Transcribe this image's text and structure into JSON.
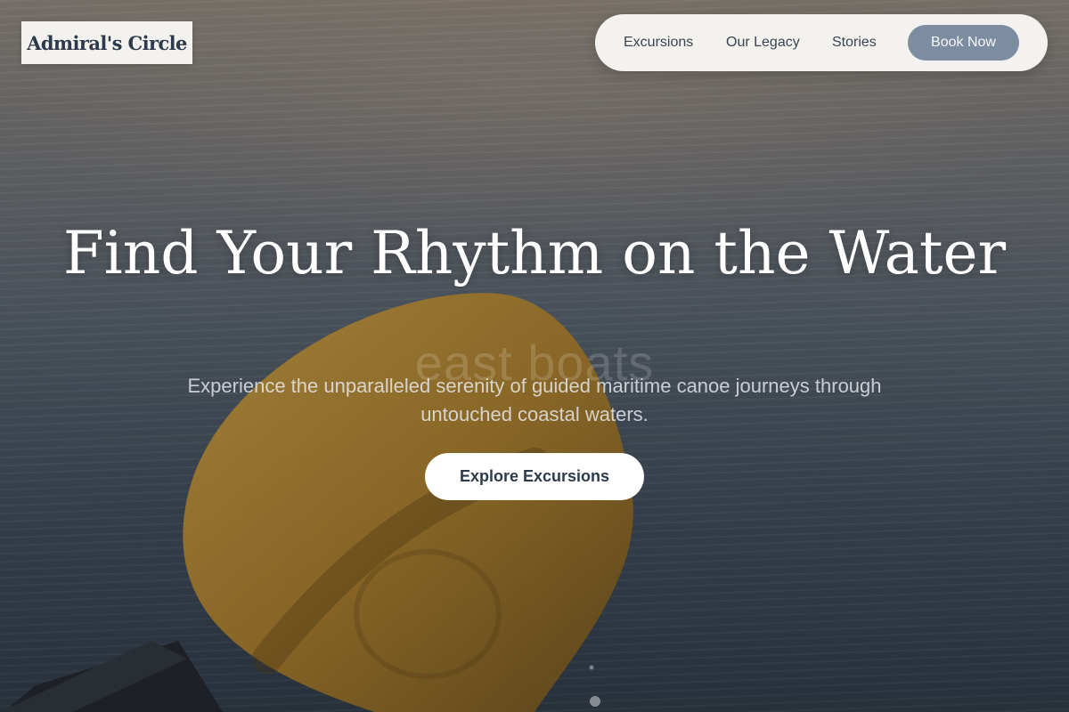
{
  "brand": {
    "logo_text": "Admiral's Circle"
  },
  "nav": {
    "links": [
      "Excursions",
      "Our Legacy",
      "Stories"
    ],
    "cta_label": "Book Now"
  },
  "hero": {
    "headline": "Find Your Rhythm on the Water",
    "ghost_text": "east boats",
    "subtitle": "Experience the unparalleled serenity of guided maritime canoe journeys through untouched coastal waters.",
    "cta_label": "Explore Excursions",
    "background_image": "canoe-paddle-over-water"
  },
  "colors": {
    "nav_pill": "#f3f2ef",
    "book_button": "#7d8da1",
    "text_dark": "#2c3a4b",
    "paddle": "#b8882a"
  }
}
